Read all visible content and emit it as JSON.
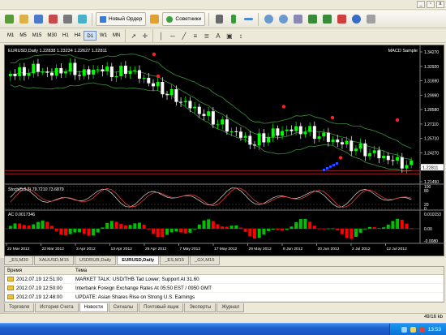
{
  "toolbar": {
    "new_order_label": "Новый Ордер",
    "experts_label": "Советники"
  },
  "timeframes": [
    "M1",
    "M5",
    "M15",
    "M30",
    "H1",
    "H4",
    "D1",
    "W1",
    "MN"
  ],
  "active_timeframe": "D1",
  "chart": {
    "symbol_info": "EURUSD,Daily 1.22838 1.23234 1.22627 1.22811",
    "expert_label": "MACD Sample",
    "price_axis": [
      "1.34270",
      "1.32920",
      "1.31690",
      "1.29990",
      "1.28580",
      "1.27110",
      "1.25710",
      "1.24270",
      "1.22811",
      "1.21450"
    ],
    "current_price": "1.22811",
    "stoch_label": "Stoch(5,3,3) 79.7210 73.6879",
    "stoch_axis": [
      "100",
      "80",
      "20",
      "0"
    ],
    "ac_label": "AC 0.0017346",
    "ac_axis": [
      "0.010153",
      "0.00",
      "-0.0080"
    ],
    "date_axis": [
      "22 Mar 2012",
      "22 Mar 2012",
      "3 Apr 2012",
      "13 Apr 2012",
      "25 Apr 2012",
      "7 May 2012",
      "17 May 2012",
      "29 May 2012",
      "8 Jun 2012",
      "20 Jun 2012",
      "2 Jul 2012",
      "12 Jul 2012"
    ],
    "colors": {
      "bull": "#00ff00",
      "bear": "#ffffff",
      "band": "#3f8f3f",
      "stoch_main": "#d8d8d8",
      "stoch_signal": "#ff4040",
      "ac_up": "#00c000",
      "ac_down": "#ff0000"
    }
  },
  "chart_tabs": [
    "_ES,M30",
    "XAUUSD,M15",
    "USDRUR,Daily",
    "EURUSD,Daily",
    "_ES,M15",
    "_GX,M15"
  ],
  "active_chart_tab": "EURUSD,Daily",
  "terminal": {
    "col_time": "Время",
    "col_topic": "Тема",
    "rows": [
      {
        "time": "2012.07.19 12:51:00",
        "topic": "MARKET TALK: USD/THB Tad Lower; Support At 31.60"
      },
      {
        "time": "2012.07.19 12:50:00",
        "topic": "Interbank Foreign Exchange Rates At 05:50 EST / 0950 GMT"
      },
      {
        "time": "2012.07.19 12:48:00",
        "topic": "UPDATE: Asian Shares Rise on Strong U.S. Earnings"
      }
    ]
  },
  "terminal_tabs": [
    "Торговля",
    "История Счета",
    "Новости",
    "Сигналы",
    "Почтовый ящик",
    "Эксперты",
    "Журнал"
  ],
  "active_terminal_tab": "Новости",
  "status": {
    "traffic": "49/16 kb"
  },
  "taskbar": {
    "clock": "13:53"
  }
}
